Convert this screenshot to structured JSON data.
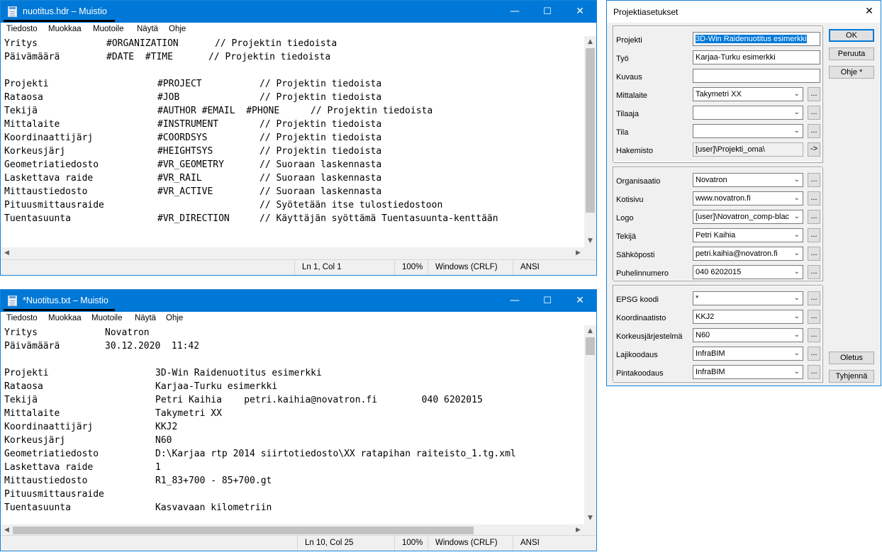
{
  "notepad1": {
    "title": "nuotitus.hdr – Muistio",
    "menu": [
      "Tiedosto",
      "Muokkaa",
      "Muotoile",
      "Näytä",
      "Ohje"
    ],
    "lines": [
      [
        "Yritys",
        "#ORGANIZATION",
        "// Projektin tiedoista"
      ],
      [
        "Päivämäärä",
        "#DATE  #TIME",
        "// Projektin tiedoista"
      ],
      [
        "",
        "",
        ""
      ],
      [
        "Projekti",
        "#PROJECT",
        "// Projektin tiedoista"
      ],
      [
        "Rataosa",
        "#JOB",
        "// Projektin tiedoista"
      ],
      [
        "Tekijä",
        "#AUTHOR #EMAIL  #PHONE",
        "// Projektin tiedoista"
      ],
      [
        "Mittalaite",
        "#INSTRUMENT",
        "// Projektin tiedoista"
      ],
      [
        "Koordinaattijärj",
        "#COORDSYS",
        "// Projektin tiedoista"
      ],
      [
        "Korkeusjärj",
        "#HEIGHTSYS",
        "// Projektin tiedoista"
      ],
      [
        "Geometriatiedosto",
        "#VR_GEOMETRY",
        "// Suoraan laskennasta"
      ],
      [
        "Laskettava raide",
        "#VR_RAIL",
        "// Suoraan laskennasta"
      ],
      [
        "Mittaustiedosto",
        "#VR_ACTIVE",
        "// Suoraan laskennasta"
      ],
      [
        "Pituusmittausraide",
        "",
        "// Syötetään itse tulostiedostoon"
      ],
      [
        "Tuentasuunta",
        "#VR_DIRECTION",
        "// Käyttäjän syöttämä Tuentasuunta-kenttään"
      ]
    ],
    "status": {
      "position": "Ln 1, Col 1",
      "zoom": "100%",
      "eol": "Windows (CRLF)",
      "encoding": "ANSI"
    }
  },
  "notepad2": {
    "title": "*Nuotitus.txt – Muistio",
    "menu": [
      "Tiedosto",
      "Muokkaa",
      "Muotoile",
      "Näytä",
      "Ohje"
    ],
    "lines": [
      [
        "Yritys",
        "Novatron",
        ""
      ],
      [
        "Päivämäärä",
        "30.12.2020  11:42",
        ""
      ],
      [
        "",
        "",
        ""
      ],
      [
        "Projekti",
        "3D-Win Raidenuotitus esimerkki",
        ""
      ],
      [
        "Rataosa",
        "Karjaa-Turku esimerkki",
        ""
      ],
      [
        "Tekijä",
        "Petri Kaihia    petri.kaihia@novatron.fi        040 6202015",
        ""
      ],
      [
        "Mittalaite",
        "Takymetri XX",
        ""
      ],
      [
        "Koordinaattijärj",
        "KKJ2",
        ""
      ],
      [
        "Korkeusjärj",
        "N60",
        ""
      ],
      [
        "Geometriatiedosto",
        "D:\\Karjaa rtp 2014 siirtotiedosto\\XX ratapihan raiteisto_1.tg.xml",
        ""
      ],
      [
        "Laskettava raide",
        "1",
        ""
      ],
      [
        "Mittaustiedosto",
        "R1_83+700 - 85+700.gt",
        ""
      ],
      [
        "Pituusmittausraide",
        "",
        ""
      ],
      [
        "Tuentasuunta",
        "Kasvavaan kilometriin",
        ""
      ]
    ],
    "status": {
      "position": "Ln 10, Col 25",
      "zoom": "100%",
      "eol": "Windows (CRLF)",
      "encoding": "ANSI"
    }
  },
  "dialog": {
    "title": "Projektiasetukset",
    "group1": [
      {
        "label": "Projekti",
        "kind": "text",
        "value": "3D-Win Raidenuotitus esimerkki",
        "selected": true
      },
      {
        "label": "Työ",
        "kind": "text",
        "value": "Karjaa-Turku esimerkki"
      },
      {
        "label": "Kuvaus",
        "kind": "text",
        "value": ""
      },
      {
        "label": "Mittalaite",
        "kind": "combo",
        "value": "Takymetri XX",
        "browse": "..."
      },
      {
        "label": "Tilaaja",
        "kind": "combo",
        "value": "",
        "browse": "..."
      },
      {
        "label": "Tila",
        "kind": "combo",
        "value": "",
        "browse": "..."
      },
      {
        "label": "Hakemisto",
        "kind": "readonly",
        "value": "[user]\\Projekti_oma\\",
        "browse": "->"
      }
    ],
    "group2": [
      {
        "label": "Organisaatio",
        "kind": "combo",
        "value": "Novatron",
        "browse": "..."
      },
      {
        "label": "Kotisivu",
        "kind": "combo",
        "value": "www.novatron.fi",
        "browse": "..."
      },
      {
        "label": "Logo",
        "kind": "combo",
        "value": "[user]\\Novatron_comp-blac",
        "browse": "..."
      },
      {
        "label": "Tekijä",
        "kind": "combo",
        "value": "Petri Kaihia",
        "browse": "..."
      },
      {
        "label": "Sähköposti",
        "kind": "combo",
        "value": "petri.kaihia@novatron.fi",
        "browse": "..."
      },
      {
        "label": "Puhelinnumero",
        "kind": "combo",
        "value": "040 6202015",
        "browse": "..."
      }
    ],
    "group3": [
      {
        "label": "EPSG koodi",
        "kind": "combo",
        "value": "*",
        "browse": "..."
      },
      {
        "label": "Koordinaatisto",
        "kind": "combo",
        "value": "KKJ2",
        "browse": "..."
      },
      {
        "label": "Korkeusjärjestelmä",
        "kind": "combo",
        "value": "N60",
        "browse": "..."
      },
      {
        "label": "Lajikoodaus",
        "kind": "combo",
        "value": "InfraBIM",
        "browse": "..."
      },
      {
        "label": "Pintakoodaus",
        "kind": "combo",
        "value": "InfraBIM",
        "browse": "..."
      }
    ],
    "buttons": {
      "ok": "OK",
      "cancel": "Peruuta",
      "help": "Ohje *",
      "defaults": "Oletus",
      "clear": "Tyhjennä"
    }
  }
}
